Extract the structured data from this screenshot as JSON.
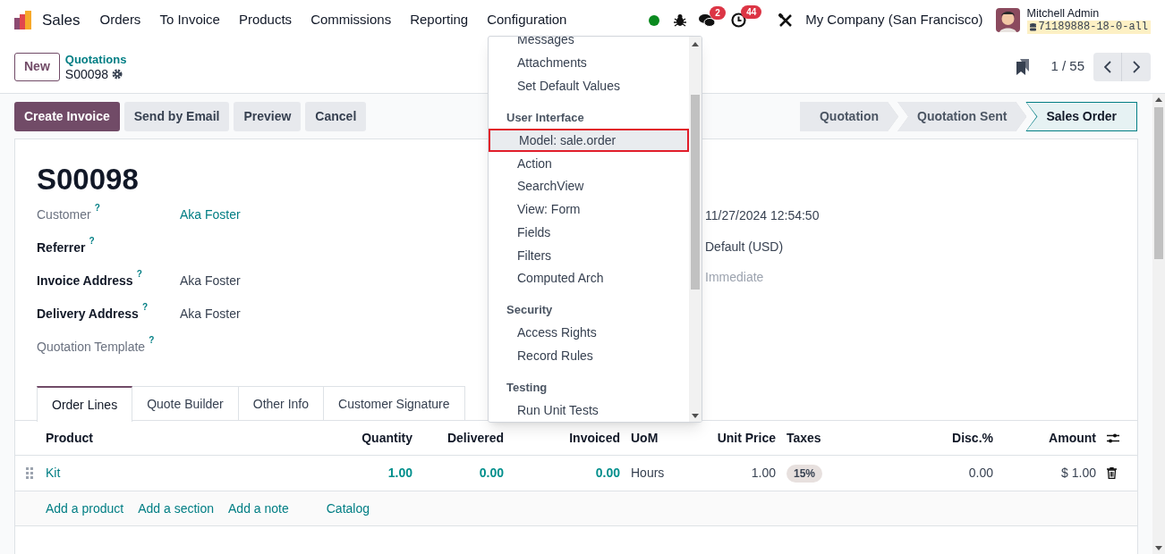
{
  "navbar": {
    "app_name": "Sales",
    "menu": [
      "Orders",
      "To Invoice",
      "Products",
      "Commissions",
      "Reporting",
      "Configuration"
    ],
    "chat_badge": "2",
    "activity_badge": "44",
    "company": "My Company (San Francisco)",
    "user_name": "Mitchell Admin",
    "database": "71189888-18-0-all"
  },
  "control_panel": {
    "new_button": "New",
    "breadcrumb": "Quotations",
    "record": "S00098",
    "pager": "1 / 55"
  },
  "action_buttons": [
    {
      "label": "Create Invoice",
      "primary": true
    },
    {
      "label": "Send by Email",
      "primary": false
    },
    {
      "label": "Preview",
      "primary": false
    },
    {
      "label": "Cancel",
      "primary": false
    }
  ],
  "status_steps": [
    {
      "label": "Quotation",
      "selected": false
    },
    {
      "label": "Quotation Sent",
      "selected": false
    },
    {
      "label": "Sales Order",
      "selected": true
    }
  ],
  "form": {
    "title": "S00098",
    "left_fields": [
      {
        "label": "Customer",
        "help": "?",
        "required": false,
        "value": "Aka Foster",
        "link": true
      },
      {
        "label": "Referrer",
        "help": "?",
        "required": true
      },
      {
        "label": "Invoice Address",
        "help": "?",
        "required": true,
        "value": "Aka Foster",
        "link": false
      },
      {
        "label": "Delivery Address",
        "help": "?",
        "required": true,
        "value": "Aka Foster",
        "link": false
      },
      {
        "label": "Quotation Template",
        "help": "?",
        "required": false
      }
    ],
    "right_fields": [
      {
        "value": "11/27/2024 12:54:50"
      },
      {
        "value": "Default (USD)"
      },
      {
        "placeholder": "Immediate"
      }
    ],
    "tabs": [
      {
        "label": "Order Lines",
        "selected": true
      },
      {
        "label": "Quote Builder",
        "selected": false
      },
      {
        "label": "Other Info",
        "selected": false
      },
      {
        "label": "Customer Signature",
        "selected": false
      }
    ],
    "table": {
      "columns": [
        "Product",
        "Quantity",
        "Delivered",
        "Invoiced",
        "UoM",
        "Unit Price",
        "Taxes",
        "Disc.%",
        "Amount"
      ],
      "rows": [
        {
          "cells": [
            {
              "kind": "link",
              "text": "Kit"
            },
            {
              "kind": "bold",
              "text": "1.00"
            },
            {
              "kind": "bold",
              "text": "0.00"
            },
            {
              "kind": "bold",
              "text": "0.00"
            },
            {
              "kind": "plain",
              "text": "Hours"
            },
            {
              "kind": "plain",
              "text": "1.00"
            },
            {
              "kind": "tag",
              "text": "15%"
            },
            {
              "kind": "plain",
              "text": "0.00"
            },
            {
              "kind": "plain",
              "text": "$ 1.00"
            }
          ]
        }
      ],
      "add_links": [
        "Add a product",
        "Add a section",
        "Add a note",
        "Catalog"
      ]
    }
  },
  "debug_menu": {
    "items": [
      {
        "kind": "item",
        "label": "Messages",
        "selected": false
      },
      {
        "kind": "item",
        "label": "Attachments",
        "selected": false
      },
      {
        "kind": "item",
        "label": "Set Default Values",
        "selected": false
      },
      {
        "kind": "header",
        "label": "User Interface"
      },
      {
        "kind": "item",
        "label": "Model: sale.order",
        "selected": true
      },
      {
        "kind": "item",
        "label": "Action",
        "selected": false
      },
      {
        "kind": "item",
        "label": "SearchView",
        "selected": false
      },
      {
        "kind": "item",
        "label": "View: Form",
        "selected": false
      },
      {
        "kind": "item",
        "label": "Fields",
        "selected": false
      },
      {
        "kind": "item",
        "label": "Filters",
        "selected": false
      },
      {
        "kind": "item",
        "label": "Computed Arch",
        "selected": false
      },
      {
        "kind": "header",
        "label": "Security"
      },
      {
        "kind": "item",
        "label": "Access Rights",
        "selected": false
      },
      {
        "kind": "item",
        "label": "Record Rules",
        "selected": false
      },
      {
        "kind": "header",
        "label": "Testing"
      },
      {
        "kind": "item",
        "label": "Run Unit Tests",
        "selected": false
      }
    ]
  }
}
